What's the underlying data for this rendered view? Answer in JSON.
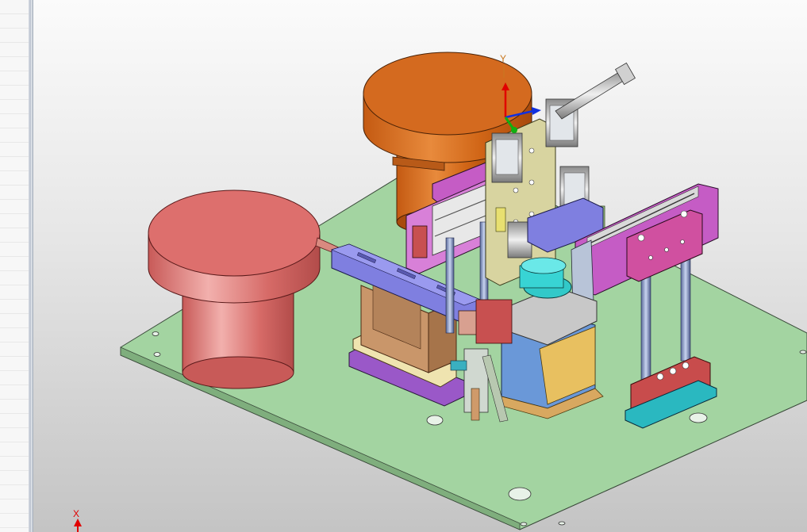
{
  "viewport": {
    "triad_labels": {
      "y": "Y"
    },
    "corner_axis_label": "X"
  },
  "colors": {
    "base_plate": "#a3d4a1",
    "bowl_orange": "#d46a1f",
    "bowl_red": "#dd6f6d",
    "purple_parts": "#c55cc5",
    "blue_parts": "#7f7fe0",
    "tan_parts": "#c9966a",
    "teal_parts": "#32c9c9"
  }
}
